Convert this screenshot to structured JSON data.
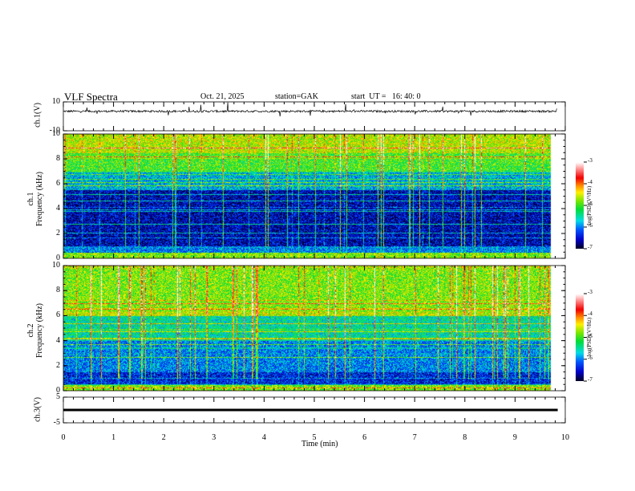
{
  "header": {
    "title": "VLF Spectra",
    "date": "Oct. 21, 2025",
    "station": "station=GAK",
    "start": "start  UT =   16: 40: 0"
  },
  "chart_data": [
    {
      "type": "line",
      "name": "ch1 waveform",
      "ylabel": "ch.1(V)",
      "ylim": [
        -10,
        10
      ],
      "yticks": [
        "10",
        "-10"
      ],
      "xlim": [
        0,
        10
      ],
      "description_values": {
        "baseline_V": 3.5,
        "noise_V": 0.5,
        "spikes": "sporadic up to ~10 V"
      }
    },
    {
      "type": "heatmap",
      "name": "ch1 spectrogram",
      "ylabel": "ch.1\nFrequency  (kHz)",
      "ylabel_lines": [
        "ch.1",
        "Frequency  (kHz)"
      ],
      "ylim": [
        0,
        10
      ],
      "yticks": [
        "0",
        "2",
        "4",
        "6",
        "8",
        "10"
      ],
      "xlim": [
        0,
        9.85
      ],
      "clim": [
        -7,
        -3
      ],
      "colorbar_label": "log(PSD)(V²/Hz)",
      "colorbar_ticks": [
        "-3",
        "-4",
        "-5",
        "-6",
        "-7"
      ],
      "band_levels": [
        {
          "f_kHz": [
            0,
            0.5
          ],
          "logpsd": -4.8
        },
        {
          "f_kHz": [
            0.5,
            1
          ],
          "logpsd": -6.0
        },
        {
          "f_kHz": [
            1,
            5.5
          ],
          "logpsd": -6.6
        },
        {
          "f_kHz": [
            5.5,
            7
          ],
          "logpsd": -5.8
        },
        {
          "f_kHz": [
            7,
            8.5
          ],
          "logpsd": -5.0
        },
        {
          "f_kHz": [
            8.5,
            10
          ],
          "logpsd": -4.6
        }
      ]
    },
    {
      "type": "heatmap",
      "name": "ch2 spectrogram",
      "ylabel_lines": [
        "ch.2",
        "Frequency  (kHz)"
      ],
      "ylim": [
        0,
        10
      ],
      "yticks": [
        "0",
        "2",
        "4",
        "6",
        "8",
        "10"
      ],
      "xlim": [
        0,
        9.85
      ],
      "clim": [
        -7,
        -3
      ],
      "colorbar_label": "log(PSD)(V²/Hz)",
      "colorbar_ticks": [
        "-3",
        "-4",
        "-5",
        "-6",
        "-7"
      ],
      "band_levels": [
        {
          "f_kHz": [
            0,
            0.5
          ],
          "logpsd": -4.8
        },
        {
          "f_kHz": [
            0.5,
            1.5
          ],
          "logpsd": -6.4
        },
        {
          "f_kHz": [
            1.5,
            4
          ],
          "logpsd": -6.0
        },
        {
          "f_kHz": [
            4,
            6
          ],
          "logpsd": -5.5
        },
        {
          "f_kHz": [
            6,
            6.4
          ],
          "logpsd": -4.6
        },
        {
          "f_kHz": [
            6.4,
            10
          ],
          "logpsd": -4.8
        }
      ]
    },
    {
      "type": "line",
      "name": "ch3 waveform",
      "ylabel": "ch.3(V)",
      "ylim": [
        -5,
        5
      ],
      "yticks": [
        "5",
        "-5"
      ],
      "xlim": [
        0,
        9.85
      ],
      "description_values": {
        "baseline_V": 0
      }
    }
  ],
  "xaxis": {
    "label": "Time  (min)",
    "ticks": [
      "0",
      "1",
      "2",
      "3",
      "4",
      "5",
      "6",
      "7",
      "8",
      "9",
      "10"
    ]
  }
}
